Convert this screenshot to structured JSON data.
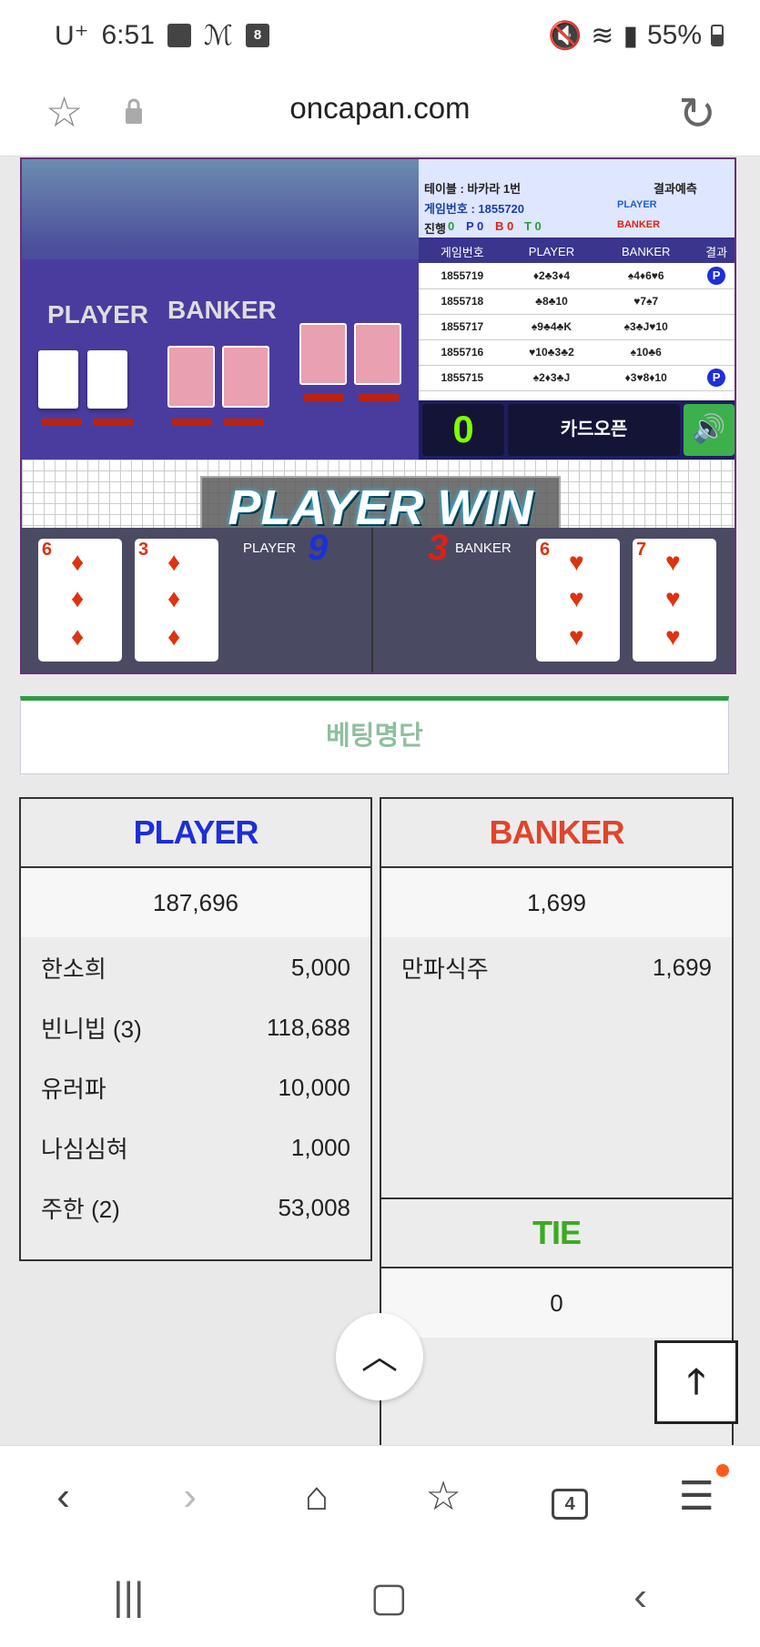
{
  "status": {
    "carrier": "U⁺",
    "time": "6:51",
    "battery": "55%",
    "badge": "8"
  },
  "browser": {
    "url": "oncapan.com"
  },
  "info": {
    "table": "테이블 : 바카라 1번",
    "predict": "결과예측",
    "gameno": "게임번호 : 1855720",
    "player": "PLAYER",
    "banker": "BANKER",
    "prog_label": "진행",
    "prog_0": "0",
    "prog_p": "P 0",
    "prog_b": "B 0",
    "prog_t": "T 0"
  },
  "history": {
    "headers": [
      "게임번호",
      "PLAYER",
      "BANKER",
      "결과"
    ],
    "rows": [
      {
        "id": "1855719",
        "p": "♦2♣3♦4",
        "b": "♠4♦6♥6",
        "r": "P"
      },
      {
        "id": "1855718",
        "p": "♣8♣10",
        "b": "♥7♠7",
        "r": ""
      },
      {
        "id": "1855717",
        "p": "♠9♣4♣K",
        "b": "♠3♣J♥10",
        "r": ""
      },
      {
        "id": "1855716",
        "p": "♥10♣3♣2",
        "b": "♠10♣6",
        "r": ""
      },
      {
        "id": "1855715",
        "p": "♠2♦3♣J",
        "b": "♦3♥8♦10",
        "r": "P"
      }
    ]
  },
  "control": {
    "count": "0",
    "open": "카드오픈",
    "sound": "🔊"
  },
  "win": {
    "text": "PLAYER WIN",
    "player_label": "PLAYER",
    "player_score": "9",
    "banker_label": "BANKER",
    "banker_score": "3"
  },
  "cards": {
    "p1": "6",
    "p2": "3",
    "b1": "6",
    "b2": "7"
  },
  "video": {
    "player": "PLAYER",
    "banker": "BANKER"
  },
  "betting": {
    "title": "베팅명단"
  },
  "player_panel": {
    "title": "PLAYER",
    "total": "187,696",
    "rows": [
      {
        "name": "한소희",
        "amount": "5,000"
      },
      {
        "name": "빈니빕 (3)",
        "amount": "118,688"
      },
      {
        "name": "유러파",
        "amount": "10,000"
      },
      {
        "name": "나심심혀",
        "amount": "1,000"
      },
      {
        "name": "주한 (2)",
        "amount": "53,008"
      }
    ]
  },
  "banker_panel": {
    "title": "BANKER",
    "total": "1,699",
    "rows": [
      {
        "name": "만파식주",
        "amount": "1,699"
      }
    ]
  },
  "tie_panel": {
    "title": "TIE",
    "total": "0"
  },
  "nav": {
    "tabs": "4"
  }
}
